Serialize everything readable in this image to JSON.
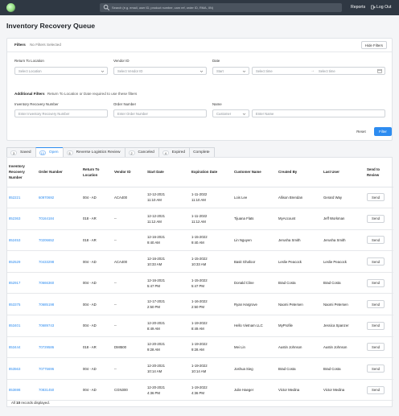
{
  "search": {
    "placeholder": "Search (e.g. email, user ID, product number, cam ref, order ID, RMA, IIN)"
  },
  "nav": {
    "reports": "Reports",
    "logout": "Log Out"
  },
  "page": {
    "title": "Inventory Recovery Queue"
  },
  "filters": {
    "heading": "Filters",
    "status": "No Filters Selected",
    "hide_button": "Hide Filters",
    "return_to_location": {
      "label": "Return To Location",
      "placeholder": "Select Location"
    },
    "vendor_id": {
      "label": "Vendor ID",
      "placeholder": "Select Vendor ID"
    },
    "date": {
      "label": "Date",
      "start_placeholder": "Start",
      "time1_placeholder": "Select time",
      "time2_placeholder": "Select time"
    },
    "additional_heading": "Additional Filters",
    "additional_note": "Return To Location or Date required to use these filters",
    "recovery_number": {
      "label": "Inventory Recovery Number",
      "placeholder": "Enter Inventory Recovery Number"
    },
    "order_number": {
      "label": "Order Number",
      "placeholder": "Enter Order Number"
    },
    "name": {
      "label": "Name",
      "select_value": "Customer",
      "placeholder": "Enter Name"
    },
    "reset_button": "Reset",
    "filter_button": "Filter"
  },
  "tabs": [
    {
      "count": "3",
      "label": "Saved"
    },
    {
      "count": "10",
      "label": "Open"
    },
    {
      "count": "5",
      "label": "Reverse Logistics Review"
    },
    {
      "count": "2",
      "label": "Canceled"
    },
    {
      "count": "4",
      "label": "Expired"
    },
    {
      "count": "",
      "label": "Complete"
    }
  ],
  "table": {
    "headers": [
      "Inventory Recovery Number",
      "Order Number",
      "Return To Location",
      "Vendor ID",
      "Start Date",
      "Expiration Date",
      "Customer Name",
      "Created By",
      "Last User",
      "Send to Review"
    ],
    "rows": [
      {
        "irn": "852221",
        "order": "60970692",
        "loc": "004 - AD",
        "vendor": "ACA400",
        "start1": "12-12-2021",
        "start2": "11:10 AM",
        "exp": "1-11-2022",
        "exp2": "11:10 AM",
        "customer": "Lois Lee",
        "created": "Allison Brendan",
        "last": "Gerard Way",
        "send": "Send"
      },
      {
        "irn": "852363",
        "order": "70164184",
        "loc": "018 - AR",
        "vendor": "--",
        "start1": "12-12-2021",
        "start2": "11:12 AM",
        "exp": "1-11-2022",
        "exp2": "11:12 AM",
        "customer": "Tijuana Flats",
        "created": "MyAccount",
        "last": "Jeff Workman",
        "send": "Send"
      },
      {
        "irn": "852453",
        "order": "70206652",
        "loc": "018 - AR",
        "vendor": "--",
        "start1": "12-16-2021",
        "start2": "9:40 AM",
        "exp": "1-15-2022",
        "exp2": "9:40 AM",
        "customer": "Lin Nguyen",
        "created": "Jerusha Smith",
        "last": "Jerusha Smith",
        "send": "Send"
      },
      {
        "irn": "852529",
        "order": "70433298",
        "loc": "004 - AD",
        "vendor": "ACA400",
        "start1": "12-16-2021",
        "start2": "10:33 AM",
        "exp": "1-15-2022",
        "exp2": "10:33 AM",
        "customer": "Basit Ghafoor",
        "created": "Leslie Peacock",
        "last": "Leslie Peacock",
        "send": "Send"
      },
      {
        "irn": "852917",
        "order": "70666360",
        "loc": "004 - AD",
        "vendor": "--",
        "start1": "12-16-2021",
        "start2": "5:47 PM",
        "exp": "1-15-2022",
        "exp2": "5:47 PM",
        "customer": "Donald Cline",
        "created": "Brad Costa",
        "last": "Brad Costa",
        "send": "Send"
      },
      {
        "irn": "853375",
        "order": "70685198",
        "loc": "004 - AD",
        "vendor": "--",
        "start1": "12-17-2021",
        "start2": "2:50 PM",
        "exp": "1-16-2022",
        "exp2": "2:50 PM",
        "customer": "Ryan Hargrove",
        "created": "Naomi Petersen",
        "last": "Naomi Petersen",
        "send": "Send"
      },
      {
        "irn": "853401",
        "order": "70689743",
        "loc": "004 - AD",
        "vendor": "--",
        "start1": "12-20-2021",
        "start2": "8:49 AM",
        "exp": "1-19-2022",
        "exp2": "8:49 AM",
        "customer": "Hello Vietnam LLC",
        "created": "MyProfile",
        "last": "Jessica Spanzer",
        "send": "Send"
      },
      {
        "irn": "853444",
        "order": "70729586",
        "loc": "018 - AR",
        "vendor": "DMI500",
        "start1": "12-20-2021",
        "start2": "9:28 AM",
        "exp": "1-19-2022",
        "exp2": "9:28 AM",
        "customer": "Mei Lin",
        "created": "Austin Johnson",
        "last": "Austin Johnson",
        "send": "Send"
      },
      {
        "irn": "853563",
        "order": "70775696",
        "loc": "004 - AD",
        "vendor": "--",
        "start1": "12-20-2021",
        "start2": "10:14 AM",
        "exp": "1-19-2022",
        "exp2": "10:14 AM",
        "customer": "Joshua Sieg",
        "created": "Brad Costa",
        "last": "Brad Costa",
        "send": "Send"
      },
      {
        "irn": "853698",
        "order": "70831450",
        "loc": "004 - AD",
        "vendor": "CGN300",
        "start1": "12-20-2021",
        "start2": "4:36 PM",
        "exp": "1-19-2022",
        "exp2": "4:36 PM",
        "customer": "Julie Haeger",
        "created": "Victor Medina",
        "last": "Victor Medina",
        "send": "Send"
      }
    ]
  },
  "footer": {
    "prefix": "All",
    "count": "10",
    "suffix": "records displayed."
  },
  "colors": {
    "accent": "#2d8cf0",
    "topbar": "#2f3843"
  }
}
